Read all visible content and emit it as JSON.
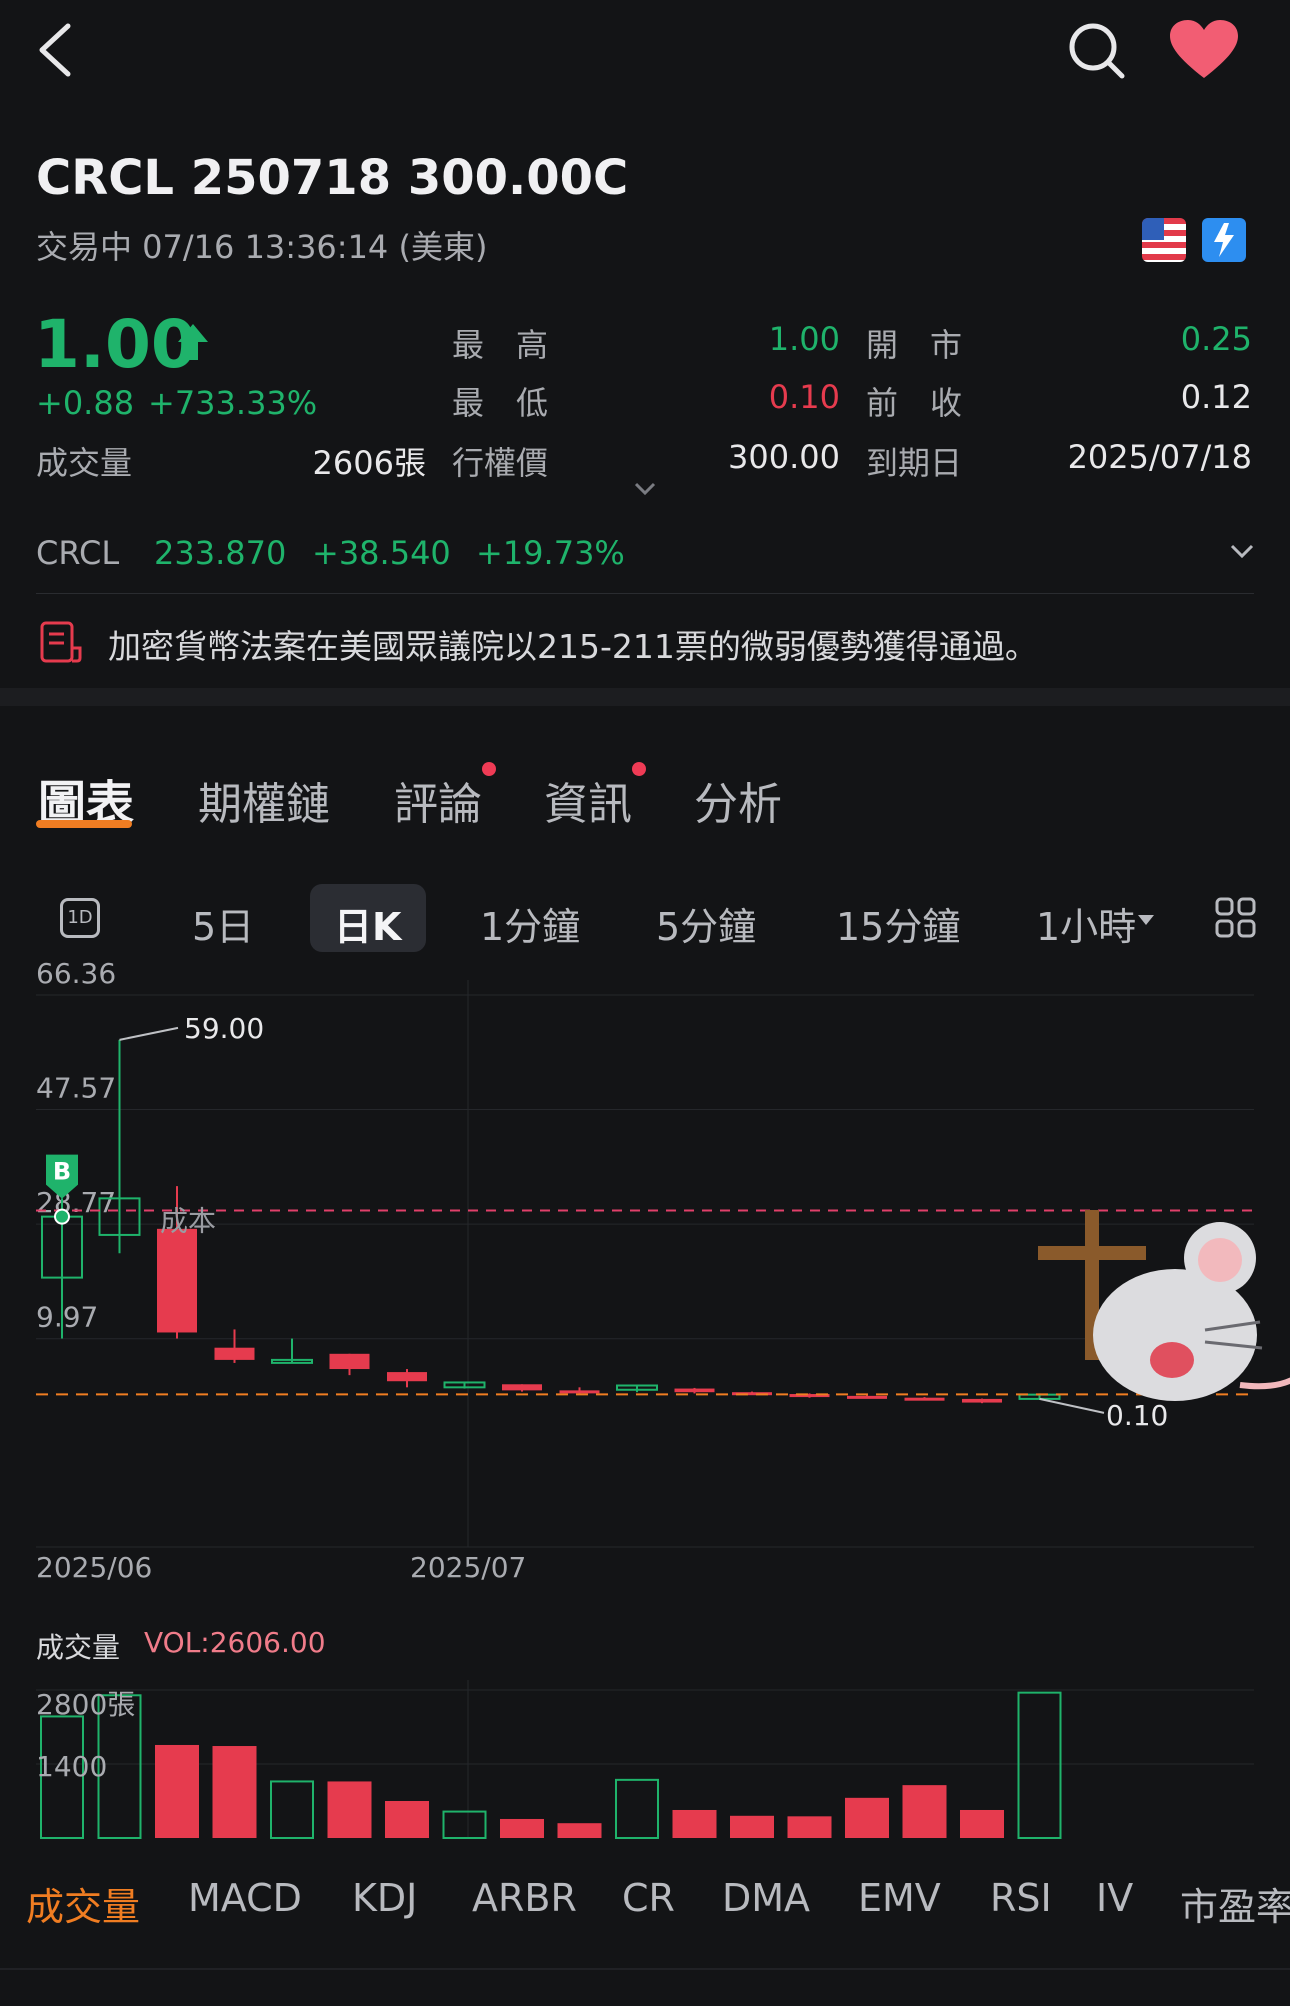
{
  "header": {
    "title": "CRCL 250718 300.00C",
    "status": "交易中 07/16 13:36:14 (美東)"
  },
  "quote": {
    "price": "1.00",
    "change": "+0.88",
    "change_pct": "+733.33%",
    "volume_label": "成交量",
    "volume_value": "2606張",
    "high_label": "最　高",
    "high": "1.00",
    "open_label": "開　市",
    "open": "0.25",
    "low_label": "最　低",
    "low": "0.10",
    "prev_close_label": "前　收",
    "prev_close": "0.12",
    "strike_label": "行權價",
    "strike": "300.00",
    "expiry_label": "到期日",
    "expiry": "2025/07/18"
  },
  "underlying": {
    "symbol": "CRCL",
    "price": "233.870",
    "change": "+38.540",
    "change_pct": "+19.73%"
  },
  "news": {
    "text": "加密貨幣法案在美國眾議院以215-211票的微弱優勢獲得通過。"
  },
  "tabs": [
    "圖表",
    "期權鏈",
    "評論",
    "資訊",
    "分析"
  ],
  "periods": {
    "icon_label": "1D",
    "items": [
      "5日",
      "日K",
      "1分鐘",
      "5分鐘",
      "15分鐘",
      "1小時"
    ],
    "active": "日K"
  },
  "chart_data": [
    {
      "type": "candlestick",
      "y_ticks": [
        "66.36",
        "47.57",
        "28.77",
        "9.97"
      ],
      "ylim": [
        -5.0,
        66.36
      ],
      "x_ticks": [
        "2025/06",
        "2025/07"
      ],
      "annotations": {
        "high": "59.00",
        "low": "0.10",
        "cost_label": "成本",
        "cost": 31.0,
        "current": 0.85,
        "buy_marker": "B"
      },
      "candles": [
        {
          "o": 20.0,
          "h": 33.0,
          "l": 10.0,
          "c": 30.0
        },
        {
          "o": 27.0,
          "h": 59.0,
          "l": 24.0,
          "c": 33.0
        },
        {
          "o": 28.0,
          "h": 35.0,
          "l": 10.0,
          "c": 11.0
        },
        {
          "o": 8.5,
          "h": 11.5,
          "l": 6.0,
          "c": 6.5
        },
        {
          "o": 6.5,
          "h": 10.0,
          "l": 6.0,
          "c": 6.5
        },
        {
          "o": 7.5,
          "h": 7.5,
          "l": 4.0,
          "c": 5.0
        },
        {
          "o": 4.5,
          "h": 5.0,
          "l": 2.0,
          "c": 3.0
        },
        {
          "o": 2.0,
          "h": 2.8,
          "l": 1.8,
          "c": 2.8
        },
        {
          "o": 2.5,
          "h": 2.5,
          "l": 1.3,
          "c": 1.5
        },
        {
          "o": 1.5,
          "h": 2.0,
          "l": 1.0,
          "c": 1.1
        },
        {
          "o": 1.6,
          "h": 2.4,
          "l": 1.2,
          "c": 2.3
        },
        {
          "o": 1.8,
          "h": 1.9,
          "l": 1.0,
          "c": 1.2
        },
        {
          "o": 1.2,
          "h": 1.3,
          "l": 0.8,
          "c": 0.9
        },
        {
          "o": 0.9,
          "h": 1.0,
          "l": 0.3,
          "c": 0.4
        },
        {
          "o": 0.6,
          "h": 0.7,
          "l": 0.2,
          "c": 0.3
        },
        {
          "o": 0.3,
          "h": 0.4,
          "l": 0.15,
          "c": 0.2
        },
        {
          "o": 0.1,
          "h": 0.15,
          "l": -0.6,
          "c": -0.5
        },
        {
          "o": 0.1,
          "h": 1.0,
          "l": 0.1,
          "c": 0.8
        }
      ]
    },
    {
      "type": "bar",
      "title": "成交量",
      "value_label": "VOL:2606.00",
      "y_ticks": [
        "2800張",
        "1400"
      ],
      "ylim": [
        0,
        2800
      ],
      "values": [
        2300,
        2700,
        1760,
        1740,
        1070,
        1070,
        700,
        500,
        360,
        280,
        1100,
        530,
        420,
        410,
        760,
        1000,
        530,
        2750
      ],
      "up": [
        true,
        true,
        false,
        false,
        true,
        false,
        false,
        true,
        false,
        false,
        true,
        false,
        false,
        false,
        false,
        false,
        false,
        true
      ]
    }
  ],
  "indicators": [
    "成交量",
    "MACD",
    "KDJ",
    "ARBR",
    "CR",
    "DMA",
    "EMV",
    "RSI",
    "IV",
    "市盈率"
  ],
  "colors": {
    "up": "#1fb36b",
    "down": "#e63b4e",
    "accent": "#f07d22",
    "bg": "#131416"
  }
}
